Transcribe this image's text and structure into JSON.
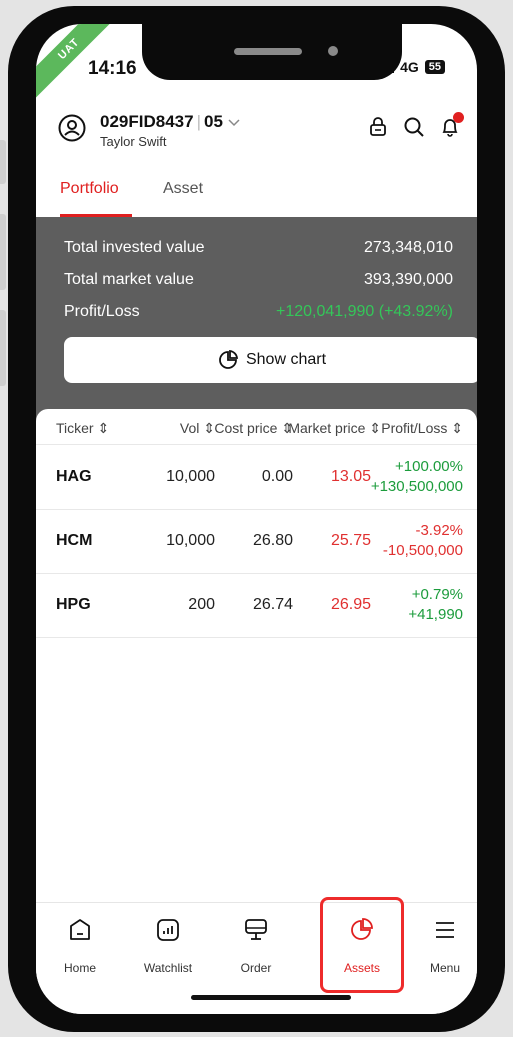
{
  "status": {
    "time": "14:16",
    "network": "4G",
    "battery": "55"
  },
  "badge": "UAT",
  "header": {
    "account_id": "029FID8437",
    "sub_account": "05",
    "name": "Taylor Swift"
  },
  "tabs": [
    {
      "label": "Portfolio",
      "active": true
    },
    {
      "label": "Asset",
      "active": false
    }
  ],
  "summary": {
    "invested_label": "Total invested value",
    "invested_value": "273,348,010",
    "market_label": "Total market value",
    "market_value": "393,390,000",
    "pl_label": "Profit/Loss",
    "pl_value": "+120,041,990 (+43.92%)",
    "chart_button": "Show chart"
  },
  "table": {
    "headers": {
      "ticker": "Ticker ⇕",
      "vol": "Vol ⇕",
      "cost": "Cost price ⇕",
      "market": "Market price ⇕",
      "pl": "Profit/Loss ⇕"
    },
    "rows": [
      {
        "ticker": "HAG",
        "vol": "10,000",
        "cost": "0.00",
        "market": "13.05",
        "pl_pct": "+100.00%",
        "pl_amt": "+130,500,000",
        "trend": "up"
      },
      {
        "ticker": "HCM",
        "vol": "10,000",
        "cost": "26.80",
        "market": "25.75",
        "pl_pct": "-3.92%",
        "pl_amt": "-10,500,000",
        "trend": "down"
      },
      {
        "ticker": "HPG",
        "vol": "200",
        "cost": "26.74",
        "market": "26.95",
        "pl_pct": "+0.79%",
        "pl_amt": "+41,990",
        "trend": "up"
      }
    ]
  },
  "nav": [
    {
      "label": "Home",
      "icon": "home-icon"
    },
    {
      "label": "Watchlist",
      "icon": "chart-icon"
    },
    {
      "label": "Order",
      "icon": "monitor-icon"
    },
    {
      "label": "Assets",
      "icon": "pie-icon",
      "active": true
    },
    {
      "label": "Menu",
      "icon": "menu-icon"
    }
  ],
  "colors": {
    "accent": "#e02020",
    "positive": "#1c9c3c",
    "negative": "#e03030",
    "summary_bg": "#5e5e5e"
  }
}
